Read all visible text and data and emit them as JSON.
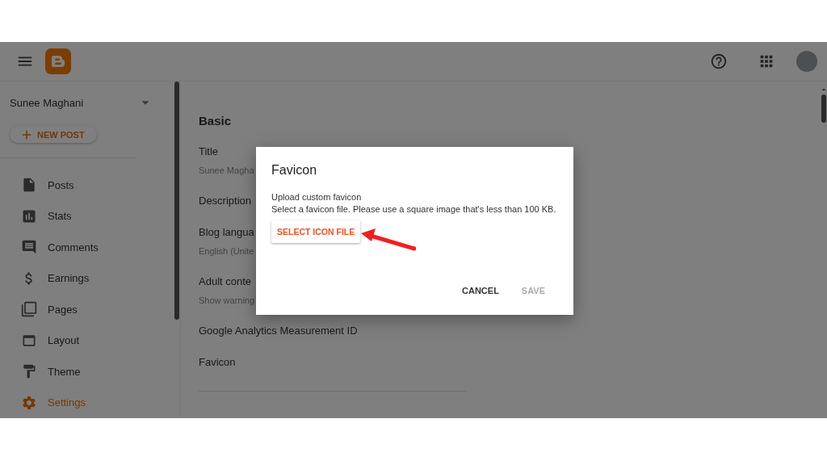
{
  "sidebar": {
    "account": "Sunee Maghani",
    "new_post": "NEW POST",
    "items": [
      {
        "label": "Posts",
        "selected": false
      },
      {
        "label": "Stats",
        "selected": false
      },
      {
        "label": "Comments",
        "selected": false
      },
      {
        "label": "Earnings",
        "selected": false
      },
      {
        "label": "Pages",
        "selected": false
      },
      {
        "label": "Layout",
        "selected": false
      },
      {
        "label": "Theme",
        "selected": false
      },
      {
        "label": "Settings",
        "selected": true
      }
    ]
  },
  "settings": {
    "section": "Basic",
    "fields": [
      {
        "label": "Title",
        "value": "Sunee Magha"
      },
      {
        "label": "Description"
      },
      {
        "label": "Blog langua",
        "value": "English (Unite"
      },
      {
        "label": "Adult conte",
        "value": "Show warning"
      },
      {
        "label": "Google Analytics Measurement ID"
      },
      {
        "label": "Favicon"
      }
    ]
  },
  "dialog": {
    "title": "Favicon",
    "heading": "Upload custom favicon",
    "text": "Select a favicon file. Please use a square image that's less than 100 KB.",
    "select_button": "SELECT ICON FILE",
    "buttons": [
      {
        "label": "CANCEL",
        "disabled": false
      },
      {
        "label": "SAVE",
        "disabled": true
      }
    ]
  }
}
